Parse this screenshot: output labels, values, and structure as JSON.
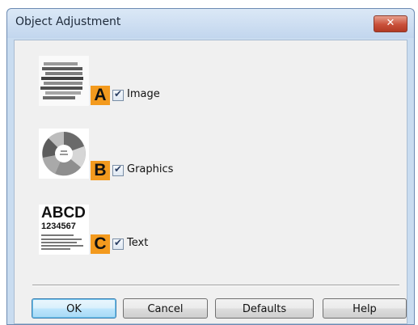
{
  "dialog": {
    "title": "Object Adjustment",
    "close_glyph": "✕"
  },
  "options": [
    {
      "letter": "A",
      "label": "Image",
      "checked": true,
      "thumbnail": "image-thumbnail"
    },
    {
      "letter": "B",
      "label": "Graphics",
      "checked": true,
      "thumbnail": "graphics-thumbnail"
    },
    {
      "letter": "C",
      "label": "Text",
      "checked": true,
      "thumbnail": "text-thumbnail",
      "thumb_text": {
        "line1": "ABCD",
        "line2": "1234567"
      }
    }
  ],
  "buttons": {
    "ok": "OK",
    "cancel": "Cancel",
    "defaults": "Defaults",
    "help": "Help"
  },
  "colors": {
    "badge": "#f39a1e",
    "close_button": "#c9503a",
    "frame": "#c9dcf0"
  }
}
